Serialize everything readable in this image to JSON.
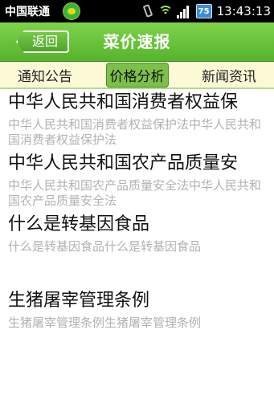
{
  "status_bar": {
    "carrier": "中国联通",
    "battery": "75",
    "time": "13:43:13"
  },
  "header": {
    "back_label": "返回",
    "title": "菜价速报"
  },
  "tabs": [
    {
      "label": "通知公告",
      "active": false
    },
    {
      "label": "价格分析",
      "active": true
    },
    {
      "label": "新闻资讯",
      "active": false
    }
  ],
  "items": [
    {
      "title": "中华人民共和国消费者权益保",
      "subtitle": "中华人民共和国消费者权益保护法中华人民共和国消费者权益保护法"
    },
    {
      "title": "中华人民共和国农产品质量安",
      "subtitle": "中华人民共和国农产品质量安全法中华人民共和国农产品质量安全法"
    },
    {
      "title": "什么是转基因食品",
      "subtitle": "什么是转基因食品什么是转基因食品"
    },
    {
      "title": "生猪屠宰管理条例",
      "subtitle": "生猪屠宰管理条例生猪屠宰管理条例"
    }
  ]
}
